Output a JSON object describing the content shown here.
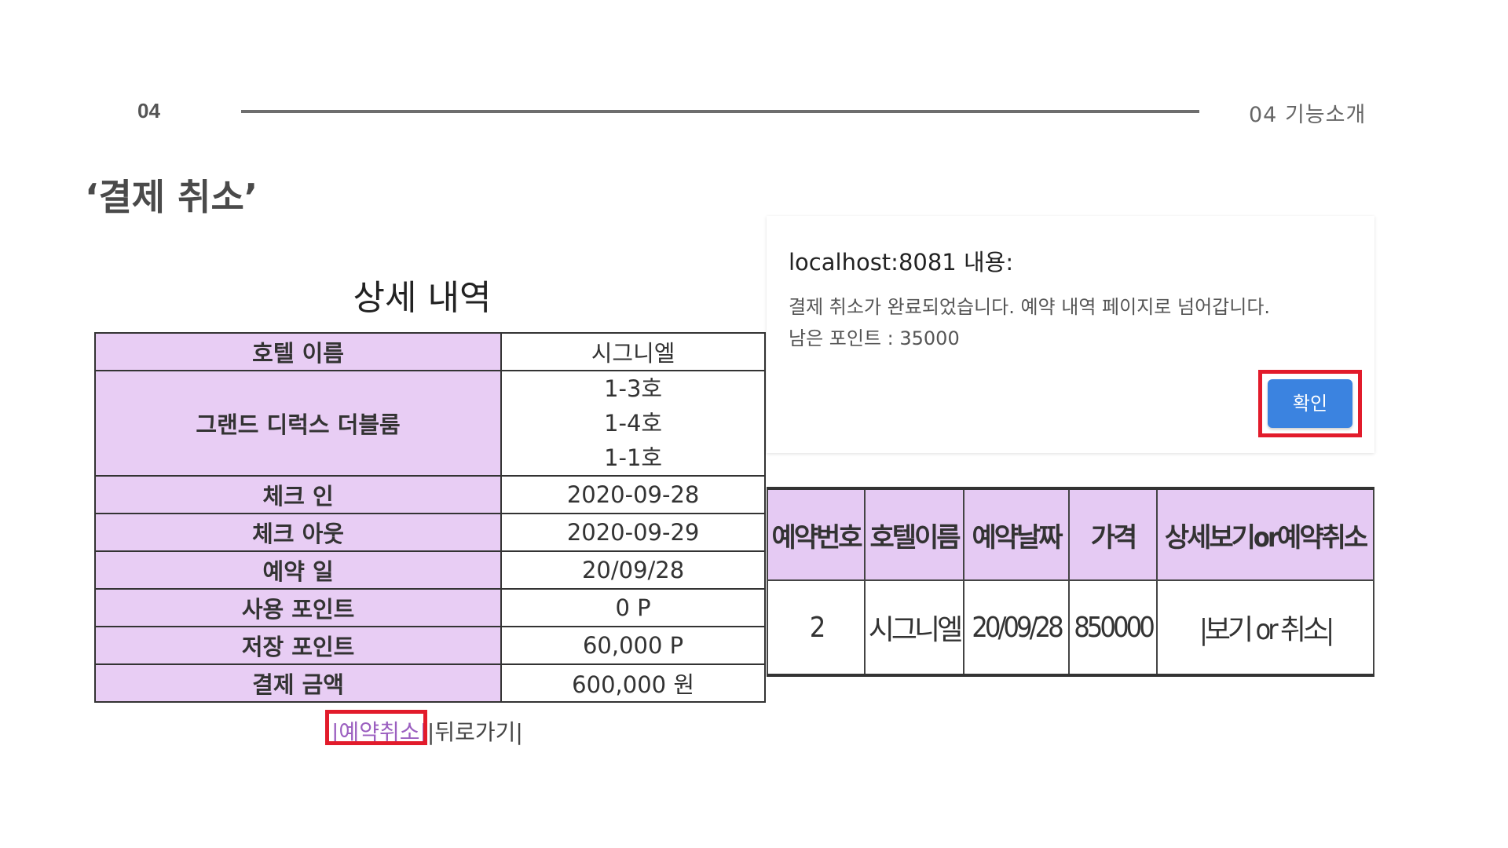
{
  "slide": {
    "number": "04",
    "section": "04 기능소개",
    "title": "‘결제 취소’"
  },
  "detail": {
    "heading": "상세 내역",
    "rows": [
      {
        "label": "호텔 이름",
        "value": "시그니엘"
      },
      {
        "label": "그랜드 디럭스 더블룸",
        "values": [
          "1-3호",
          "1-4호",
          "1-1호"
        ]
      },
      {
        "label": "체크 인",
        "value": "2020-09-28"
      },
      {
        "label": "체크 아웃",
        "value": "2020-09-29"
      },
      {
        "label": "예약 일",
        "value": "20/09/28"
      },
      {
        "label": "사용 포인트",
        "value": "0 P"
      },
      {
        "label": "저장 포인트",
        "value": "60,000 P"
      },
      {
        "label": "결제 금액",
        "value": "600,000 원"
      }
    ],
    "cancel_link": "|예약취소|",
    "back_link": "|뒤로가기|"
  },
  "dialog": {
    "title": "localhost:8081 내용:",
    "message_line1": "결제 취소가 완료되었습니다. 예약 내역 페이지로 넘어갑니다.",
    "message_line2": "남은 포인트 : 35000",
    "confirm_label": "확인",
    "button_color": "#3b83e0"
  },
  "reservations": {
    "columns": [
      "예약번호",
      "호텔이름",
      "예약날짜",
      "가격",
      "상세보기or예약취소"
    ],
    "rows": [
      [
        "2",
        "시그니엘",
        "20/09/28",
        "850000",
        "|보기 or 취소|"
      ]
    ]
  },
  "colors": {
    "label_cell_bg": "#e8cdf4",
    "highlight_box": "#e21b2b"
  }
}
